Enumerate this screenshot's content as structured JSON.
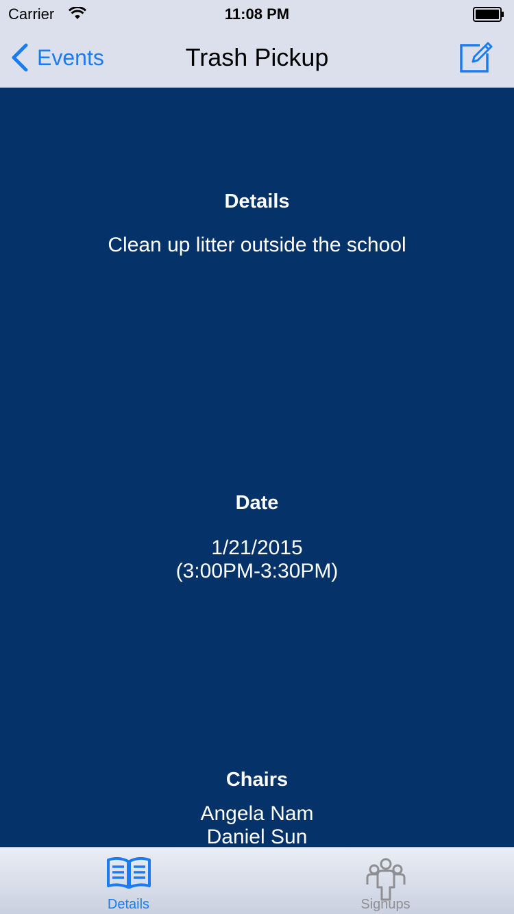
{
  "status_bar": {
    "carrier": "Carrier",
    "time": "11:08 PM",
    "icons": [
      "wifi-icon",
      "battery-icon"
    ]
  },
  "nav": {
    "back_label": "Events",
    "title": "Trash Pickup",
    "edit_icon": "edit-icon"
  },
  "sections": {
    "details": {
      "heading": "Details",
      "text": "Clean up litter outside the school"
    },
    "date": {
      "heading": "Date",
      "line1": "1/21/2015",
      "line2": "(3:00PM-3:30PM)"
    },
    "chairs": {
      "heading": "Chairs",
      "names": [
        "Angela Nam",
        "Daniel Sun"
      ]
    }
  },
  "tabbar": {
    "tabs": [
      {
        "label": "Details",
        "icon": "book-icon",
        "selected": true
      },
      {
        "label": "Signups",
        "icon": "people-icon",
        "selected": false
      }
    ]
  },
  "colors": {
    "accent": "#1a7cf0",
    "background": "#06326a",
    "nav_bg": "#dbe0ec",
    "inactive_tab": "#8e8e93"
  }
}
